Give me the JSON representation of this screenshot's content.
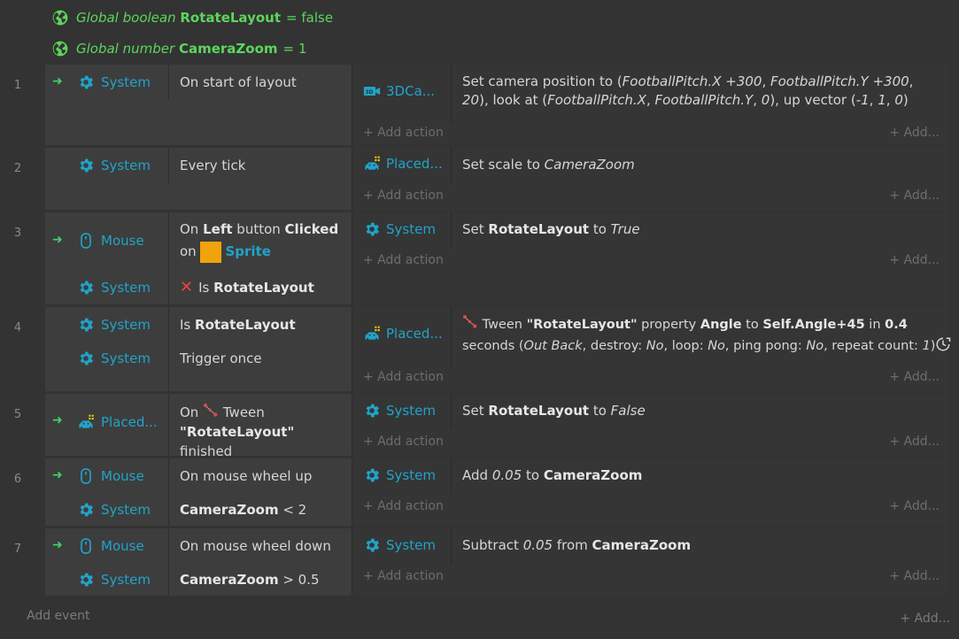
{
  "globals": [
    {
      "scope": "Global boolean",
      "name": "RotateLayout",
      "value": "= false"
    },
    {
      "scope": "Global number",
      "name": "CameraZoom",
      "value": "= 1"
    }
  ],
  "ui": {
    "add_action": "+ Add action",
    "add_more": "+ Add...",
    "add_event": "Add event"
  },
  "icons": {
    "globe": "globe-icon",
    "system": "gear-icon",
    "mouse": "mouse-icon",
    "placed": "sprite-icon",
    "camera": "3d-camera-icon",
    "tween": "tween-icon",
    "invert": "x-icon",
    "repeat": "repeat-icon"
  },
  "colors": {
    "accent": "#20a4c9",
    "global_green": "#5cd65c",
    "trigger_arrow": "#3fd16a",
    "sprite_orange": "#f0a30a",
    "invert_red": "#e84545"
  },
  "events": [
    {
      "num": "1",
      "conditions": [
        {
          "object": "System",
          "text": "On start of layout"
        }
      ],
      "actions": [
        {
          "object": "3DCa...",
          "text": "Set camera position to (FootballPitch.X +300, FootballPitch.Y +300, 20), look at (FootballPitch.X, FootballPitch.Y, 0), up vector (-1, 1, 0)"
        }
      ]
    },
    {
      "num": "2",
      "conditions": [
        {
          "object": "System",
          "text": "Every tick"
        }
      ],
      "actions": [
        {
          "object": "Placed...",
          "text": "Set scale to CameraZoom"
        }
      ]
    },
    {
      "num": "3",
      "conditions": [
        {
          "object": "Mouse",
          "text_parts": [
            "On ",
            "Left",
            " button ",
            "Clicked",
            "on",
            "Sprite"
          ]
        },
        {
          "object": "System",
          "text_parts": [
            "Is ",
            "RotateLayout"
          ]
        }
      ],
      "actions": [
        {
          "object": "System",
          "text_parts": [
            "Set ",
            "RotateLayout",
            " to ",
            "True"
          ]
        }
      ]
    },
    {
      "num": "4",
      "conditions": [
        {
          "object": "System",
          "text_parts": [
            "Is ",
            "RotateLayout"
          ]
        },
        {
          "object": "System",
          "text": "Trigger once"
        }
      ],
      "actions": [
        {
          "object": "Placed...",
          "text_parts": [
            "Tween ",
            "\"RotateLayout\"",
            " property ",
            "Angle",
            " to ",
            "Self.Angle+45",
            " in ",
            "0.4",
            "seconds (",
            "Out Back",
            ", destroy: ",
            "No",
            ", loop: ",
            "No",
            ", ping pong: ",
            "No",
            ", repeat count: ",
            "1",
            ")"
          ]
        }
      ]
    },
    {
      "num": "5",
      "conditions": [
        {
          "object": "Placed...",
          "text_parts": [
            "On ",
            "Tween",
            "\"RotateLayout\"",
            " finished"
          ]
        }
      ],
      "actions": [
        {
          "object": "System",
          "text_parts": [
            "Set ",
            "RotateLayout",
            " to ",
            "False"
          ]
        }
      ]
    },
    {
      "num": "6",
      "conditions": [
        {
          "object": "Mouse",
          "text": "On mouse wheel up"
        },
        {
          "object": "System",
          "text_parts": [
            "CameraZoom",
            " < 2"
          ]
        }
      ],
      "actions": [
        {
          "object": "System",
          "text_parts": [
            "Add ",
            "0.05",
            " to ",
            "CameraZoom"
          ]
        }
      ]
    },
    {
      "num": "7",
      "conditions": [
        {
          "object": "Mouse",
          "text": "On mouse wheel down"
        },
        {
          "object": "System",
          "text_parts": [
            "CameraZoom",
            " > 0.5"
          ]
        }
      ],
      "actions": [
        {
          "object": "System",
          "text_parts": [
            "Subtract ",
            "0.05",
            " from ",
            "CameraZoom"
          ]
        }
      ]
    }
  ]
}
